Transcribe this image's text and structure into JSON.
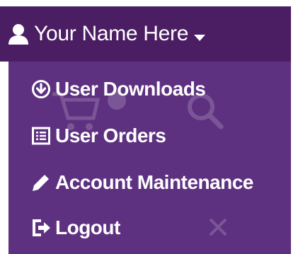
{
  "colors": {
    "toggle_bg": "#4b1d63",
    "menu_bg": "#5e3180",
    "text": "#ffffff"
  },
  "user_menu": {
    "name": "Your Name Here",
    "toggle_icon": "user-icon",
    "caret_icon": "caret-down-icon"
  },
  "dropdown": {
    "items": [
      {
        "label": "User Downloads",
        "icon": "download-circle-icon"
      },
      {
        "label": "User Orders",
        "icon": "list-alt-icon"
      },
      {
        "label": "Account Maintenance",
        "icon": "pencil-icon"
      },
      {
        "label": "Logout",
        "icon": "logout-icon"
      }
    ]
  }
}
